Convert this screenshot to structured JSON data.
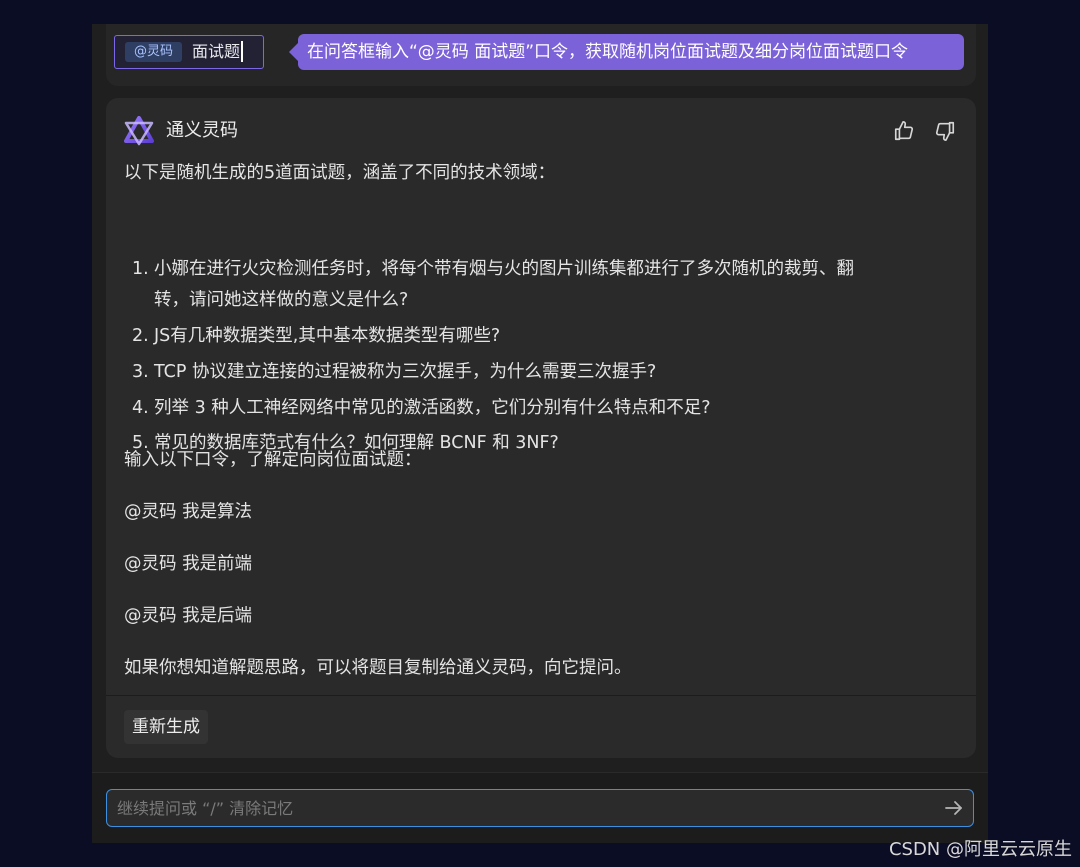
{
  "command_bar": {
    "mention_tag": "@灵码",
    "input_text": "面试题",
    "tooltip": "在问答框输入“@灵码 面试题”口令，获取随机岗位面试题及细分岗位面试题口令"
  },
  "message": {
    "assistant_name": "通义灵码",
    "intro": "以下是随机生成的5道面试题，涵盖了不同的技术领域：",
    "questions": [
      {
        "num": "1.",
        "line1": "小娜在进行火灾检测任务时，将每个带有烟与火的图片训练集都进行了多次随机的裁剪、翻",
        "line2": "转，请问她这样做的意义是什么?"
      },
      {
        "num": "2.",
        "line1": "JS有几种数据类型,其中基本数据类型有哪些?"
      },
      {
        "num": "3.",
        "line1": "TCP 协议建立连接的过程被称为三次握手，为什么需要三次握手?"
      },
      {
        "num": "4.",
        "line1": "列举 3 种人工神经网络中常见的激活函数，它们分别有什么特点和不足?"
      },
      {
        "num": "5.",
        "line1": "常见的数据库范式有什么？如何理解 BCNF 和 3NF?"
      }
    ],
    "commands_intro": "输入以下口令，了解定向岗位面试题：",
    "commands": [
      "@灵码 我是算法",
      "@灵码 我是前端",
      "@灵码 我是后端"
    ],
    "closing": "如果你想知道解题思路，可以将题目复制给通义灵码，向它提问。"
  },
  "actions": {
    "regenerate_label": "重新生成"
  },
  "chat_input": {
    "placeholder": "继续提问或 “/” 清除记忆",
    "value": ""
  },
  "icons": {
    "like": "thumbs-up-icon",
    "dislike": "thumbs-down-icon",
    "send": "arrow-right-icon",
    "logo": "tongyi-lingma-logo"
  },
  "colors": {
    "background": "#0b0d24",
    "panel": "#1f1f1f",
    "card": "#2a2a2a",
    "tooltip": "#7c62d9",
    "input_border": "#3d8fe0",
    "mention_tag": "#2f3f63"
  },
  "watermark": "CSDN @阿里云云原生"
}
